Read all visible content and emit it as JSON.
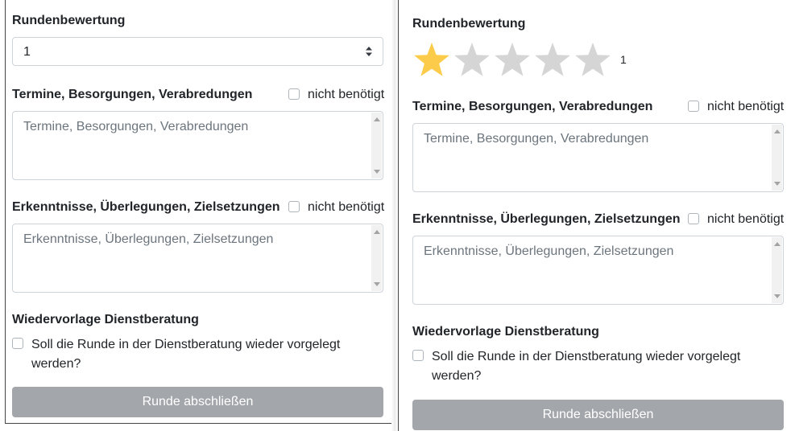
{
  "left": {
    "rating_heading": "Rundenbewertung",
    "rating_select_value": "1",
    "termine_heading": "Termine, Besorgungen, Verabredungen",
    "termine_not_needed": "nicht benötigt",
    "termine_placeholder": "Termine, Besorgungen, Verabredungen",
    "erkenntnisse_heading": "Erkenntnisse, Überlegungen, Zielsetzungen",
    "erkenntnisse_not_needed": "nicht benötigt",
    "erkenntnisse_placeholder": "Erkenntnisse, Überlegungen, Zielsetzungen",
    "wiedervorlage_heading": "Wiedervorlage Dienstberatung",
    "wiedervorlage_line1": "Soll die Runde in der Dienstberatung wieder vorgelegt",
    "wiedervorlage_line2": "werden?",
    "finish_button": "Runde abschließen"
  },
  "right": {
    "rating_heading": "Rundenbewertung",
    "rating_value": "1",
    "stars_filled": 1,
    "stars_total": 5,
    "termine_heading": "Termine, Besorgungen, Verabredungen",
    "termine_not_needed": "nicht benötigt",
    "termine_placeholder": "Termine, Besorgungen, Verabredungen",
    "erkenntnisse_heading": "Erkenntnisse, Überlegungen, Zielsetzungen",
    "erkenntnisse_not_needed": "nicht benötigt",
    "erkenntnisse_placeholder": "Erkenntnisse, Überlegungen, Zielsetzungen",
    "wiedervorlage_heading": "Wiedervorlage Dienstberatung",
    "wiedervorlage_line1": "Soll die Runde in der Dienstberatung wieder vorgelegt",
    "wiedervorlage_line2": "werden?",
    "finish_button": "Runde abschließen"
  },
  "colors": {
    "star_filled": "#fdcb4a",
    "star_empty": "#d5d5d5",
    "button_bg": "#a3a7ab",
    "placeholder": "#6c757d"
  }
}
